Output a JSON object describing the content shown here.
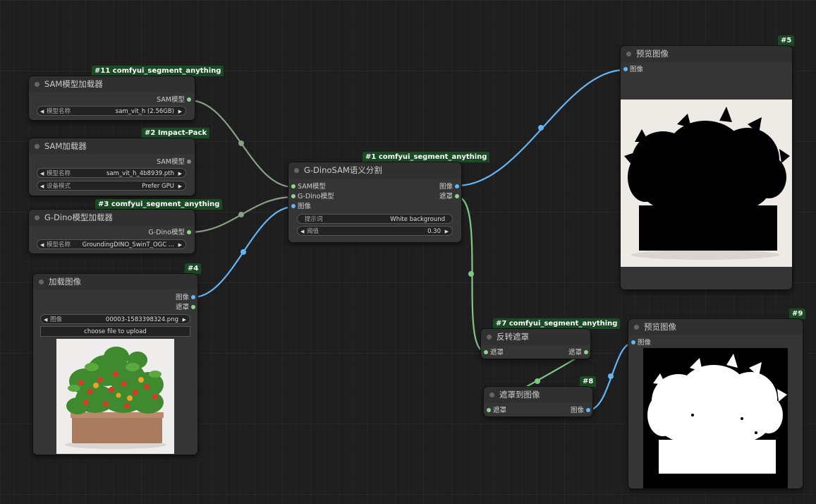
{
  "nodes": {
    "sam_loader": {
      "badge": "#11 comfyui_segment_anything",
      "title": "SAM模型加载器",
      "output": "SAM模型",
      "widget_label": "模型名称",
      "widget_value": "sam_vit_h (2.56GB)"
    },
    "impact_sam": {
      "badge": "#2 Impact-Pack",
      "title": "SAM加载器",
      "output": "SAM模型",
      "widget1_label": "模型名称",
      "widget1_value": "sam_vit_h_4b8939.pth",
      "widget2_label": "设备模式",
      "widget2_value": "Prefer GPU"
    },
    "gdino_loader": {
      "badge": "#3 comfyui_segment_anything",
      "title": "G-Dino模型加载器",
      "output": "G-Dino模型",
      "widget_label": "模型名称",
      "widget_value": "GroundingDINO_SwinT_OGC ..."
    },
    "load_image": {
      "badge": "#4",
      "title": "加载图像",
      "output_image": "图像",
      "output_mask": "遮罩",
      "widget_label": "图像",
      "widget_value": "00003-1583398324.png",
      "upload_label": "choose file to upload"
    },
    "gdino_sam": {
      "badge": "#1 comfyui_segment_anything",
      "title": "G-DinoSAM语义分割",
      "input_sam": "SAM模型",
      "input_gdino": "G-Dino模型",
      "input_image": "图像",
      "output_image": "图像",
      "output_mask": "遮罩",
      "prompt_label": "提示词",
      "prompt_value": "White background",
      "threshold_label": "阈值",
      "threshold_value": "0.30"
    },
    "preview5": {
      "badge": "#5",
      "title": "预览图像",
      "input": "图像"
    },
    "invert_mask": {
      "badge": "#7 comfyui_segment_anything",
      "title": "反转遮罩",
      "input": "遮罩",
      "output": "遮罩"
    },
    "mask_to_image": {
      "badge": "#8",
      "title": "遮罩到图像",
      "input": "遮罩",
      "output": "图像"
    },
    "preview9": {
      "badge": "#9",
      "title": "预览图像",
      "input": "图像"
    }
  },
  "colors": {
    "canvas": "#1e1e1e",
    "node_body": "#353535",
    "badge_bg": "#1b4b24",
    "link_sam": "#8a9e88",
    "link_image": "#64b5f6",
    "link_mask": "#81c784"
  }
}
